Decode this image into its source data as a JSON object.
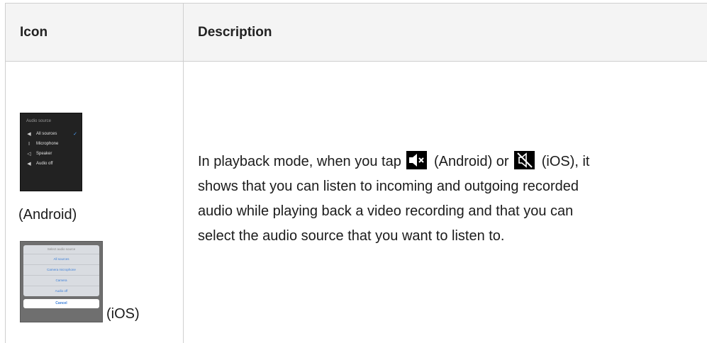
{
  "table": {
    "headers": {
      "icon": "Icon",
      "description": "Description"
    },
    "row": {
      "android_caption": "(Android)",
      "ios_caption": "(iOS)",
      "description": {
        "part1": "In playback mode, when you tap",
        "part2": "(Android) or",
        "part3": "(iOS), it",
        "line2": "shows that you can listen to incoming and outgoing recorded",
        "line3": "audio while playing back a video recording and that you can",
        "line4": "select the audio source that you want to listen to."
      }
    }
  },
  "android_menu": {
    "title": "Audio source",
    "items": [
      {
        "label": "All sources",
        "icon": "speaker-icon",
        "checked": true
      },
      {
        "label": "Microphone",
        "icon": "microphone-icon",
        "checked": false
      },
      {
        "label": "Speaker",
        "icon": "speaker-outline-icon",
        "checked": false
      },
      {
        "label": "Audio off",
        "icon": "speaker-mute-icon",
        "checked": false
      }
    ]
  },
  "ios_menu": {
    "title": "Select audio source",
    "items": [
      "All sources",
      "Camera microphone",
      "Camera",
      "Audio off"
    ],
    "cancel": "Cancel"
  },
  "colors": {
    "header_bg": "#f4f4f4",
    "border": "#cfcfcf",
    "ios_link": "#3b7fd9"
  }
}
